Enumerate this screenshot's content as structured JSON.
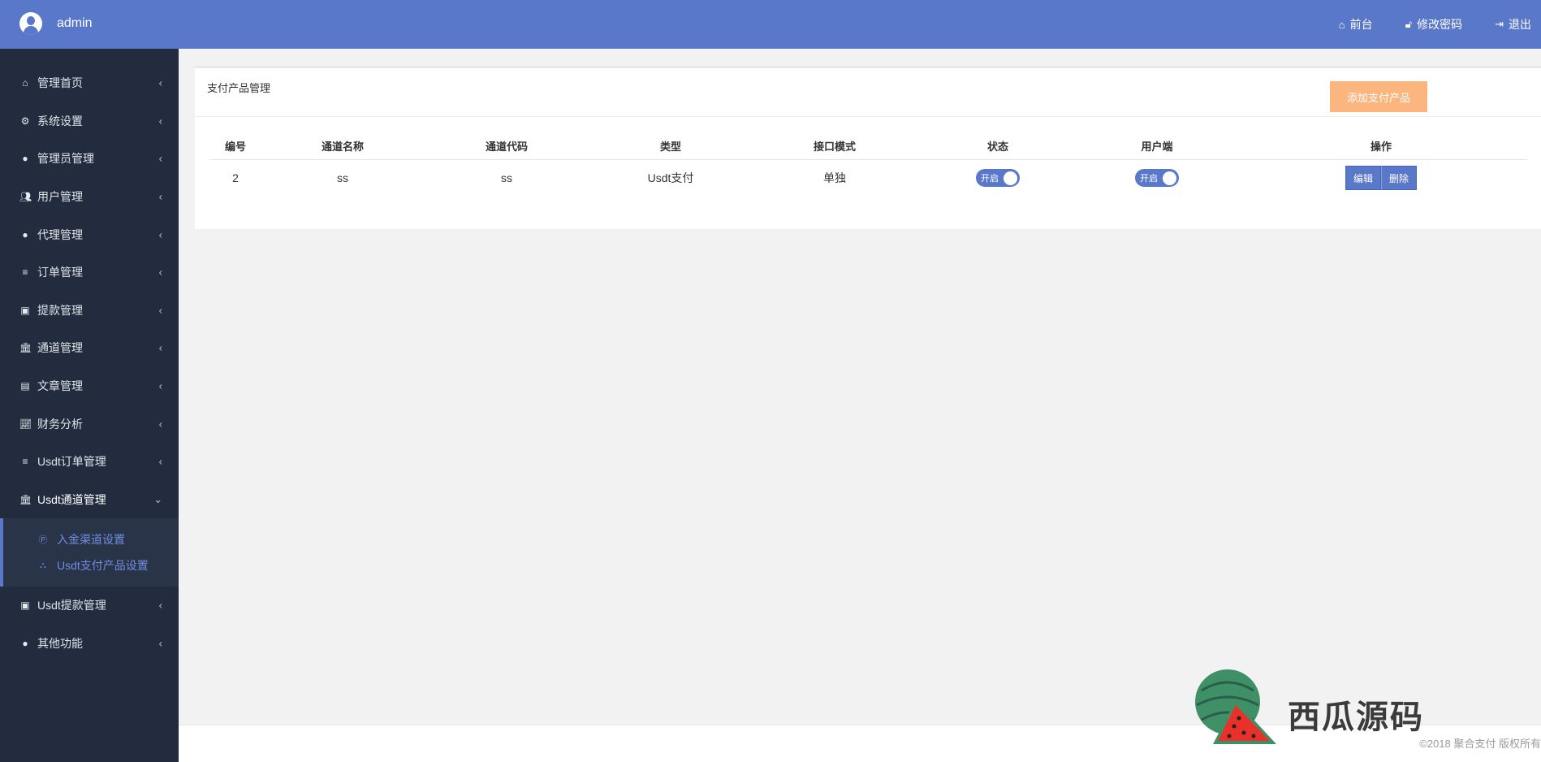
{
  "header": {
    "username": "admin",
    "nav": [
      {
        "label": "前台",
        "icon": "home-icon"
      },
      {
        "label": "修改密码",
        "icon": "lock-icon"
      },
      {
        "label": "退出",
        "icon": "logout-icon"
      }
    ]
  },
  "sidebar": {
    "items": [
      {
        "label": "管理首页",
        "icon": "home-icon"
      },
      {
        "label": "系统设置",
        "icon": "gears-icon"
      },
      {
        "label": "管理员管理",
        "icon": "user-circle-icon"
      },
      {
        "label": "用户管理",
        "icon": "users-icon"
      },
      {
        "label": "代理管理",
        "icon": "user-circle-icon"
      },
      {
        "label": "订单管理",
        "icon": "list-icon"
      },
      {
        "label": "提款管理",
        "icon": "lock-icon"
      },
      {
        "label": "通道管理",
        "icon": "bank-icon"
      },
      {
        "label": "文章管理",
        "icon": "book-icon"
      },
      {
        "label": "财务分析",
        "icon": "line-chart-icon"
      },
      {
        "label": "Usdt订单管理",
        "icon": "list-icon"
      },
      {
        "label": "Usdt通道管理",
        "icon": "bank-icon",
        "open": true
      },
      {
        "label": "Usdt提款管理",
        "icon": "lock-icon"
      },
      {
        "label": "其他功能",
        "icon": "user-circle-icon"
      }
    ],
    "submenu": [
      {
        "label": "入金渠道设置",
        "icon": "parking-icon"
      },
      {
        "label": "Usdt支付产品设置",
        "icon": "sitemap-icon"
      }
    ]
  },
  "panel": {
    "title": "支付产品管理",
    "add_button": "添加支付产品"
  },
  "table": {
    "headers": [
      "编号",
      "通道名称",
      "通道代码",
      "类型",
      "接口模式",
      "状态",
      "用户端",
      "操作"
    ],
    "rows": [
      {
        "id": "2",
        "name": "ss",
        "code": "ss",
        "type": "Usdt支付",
        "mode": "单独",
        "status": "开启",
        "client": "开启"
      }
    ],
    "edit_label": "编辑",
    "delete_label": "删除"
  },
  "footer": {
    "copyright": "©2018 聚合支付 版权所有"
  },
  "watermark": {
    "text": "西瓜源码"
  },
  "colors": {
    "primary": "#5a78ca",
    "sidebar": "#232c3e",
    "add_button": "#fbb57e"
  }
}
